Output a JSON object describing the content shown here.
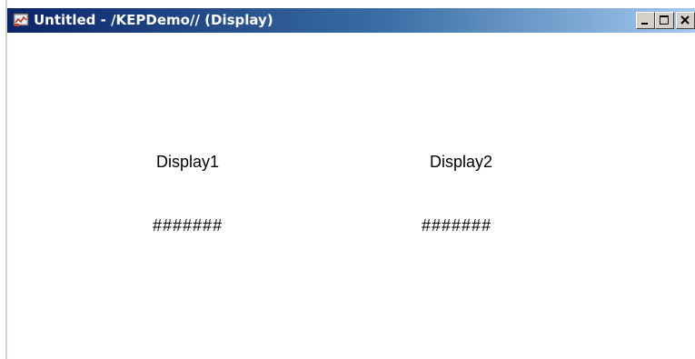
{
  "window": {
    "title": "Untitled - /KEPDemo// (Display)",
    "icon": "display-app-icon",
    "buttons": {
      "minimize": "minimize-icon",
      "maximize": "maximize-icon",
      "close": "close-icon"
    },
    "colors": {
      "titlebar_start": "#0a246a",
      "titlebar_end": "#a6caf0",
      "button_face": "#d4d0c8"
    }
  },
  "displays": [
    {
      "label": "Display1",
      "value": "#######"
    },
    {
      "label": "Display2",
      "value": "#######"
    }
  ]
}
